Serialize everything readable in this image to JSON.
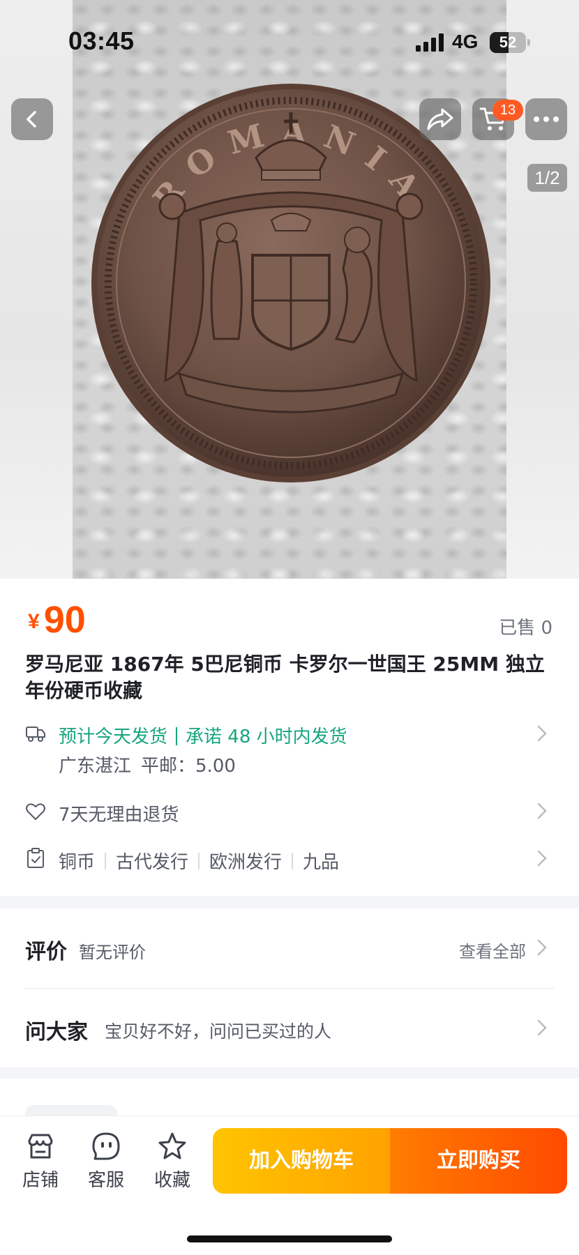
{
  "status_bar": {
    "time": "03:45",
    "network": "4G",
    "battery_level": "52",
    "battery_fraction": 0.52
  },
  "gallery": {
    "pager": "1/2",
    "coin_legend": "ROMANIA"
  },
  "top_nav": {
    "cart_count": "13",
    "icons": [
      "back-arrow-icon",
      "share-icon",
      "cart-icon",
      "more-icon"
    ]
  },
  "product": {
    "price_currency": "¥",
    "price": "90",
    "sold": "已售 0",
    "title": "罗马尼亚 1867年 5巴尼铜币 卡罗尔一世国王 25MM 独立年份硬币收藏"
  },
  "shipping": {
    "eta": "预计今天发货",
    "promise": "承诺 48 小时内发货",
    "origin": "广东湛江",
    "fee": "平邮：5.00"
  },
  "returns": {
    "label": "7天无理由退货"
  },
  "attributes": [
    "铜币",
    "古代发行",
    "欧洲发行",
    "九品"
  ],
  "reviews": {
    "title": "评价",
    "subtitle": "暂无评价",
    "view_all": "查看全部"
  },
  "ask": {
    "title": "问大家",
    "subtitle": "宝贝好不好，问问已买过的人"
  },
  "bottom_bar": {
    "store": "店铺",
    "service": "客服",
    "favorite": "收藏",
    "add_to_cart": "加入购物车",
    "buy_now": "立即购买"
  },
  "colors": {
    "price": "#ff5000",
    "shipping": "#17a57c",
    "cart_button": "#ffb000",
    "buy_button": "#ff5a00"
  }
}
